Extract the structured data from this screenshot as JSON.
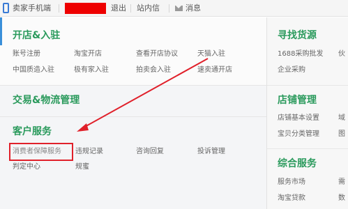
{
  "topbar": {
    "mobile_label": "卖家手机端",
    "logout": "退出",
    "messages_site": "站内信",
    "messages": "消息"
  },
  "sections": {
    "shop_open": {
      "title": "开店&入驻",
      "links": [
        "账号注册",
        "淘宝开店",
        "查看开店协议",
        "天猫入驻",
        "中国质造入驻",
        "极有家入驻",
        "拍卖会入驻",
        "速卖通开店"
      ]
    },
    "logistics": {
      "title": "交易&物流管理"
    },
    "customer": {
      "title": "客户服务",
      "links": [
        "消费者保障服务",
        "违规记录",
        "咨询回复",
        "投诉管理",
        "判定中心",
        "规蜜"
      ]
    }
  },
  "right": {
    "sourcing": {
      "title": "寻找货源",
      "links": [
        "1688采购批发",
        "伙",
        "企业采购"
      ]
    },
    "shop_mgmt": {
      "title": "店铺管理",
      "links": [
        "店铺基本设置",
        "域",
        "宝贝分类管理",
        "图"
      ]
    },
    "general": {
      "title": "综合服务",
      "links": [
        "服务市场",
        "需",
        "淘宝贷款",
        "数"
      ]
    }
  },
  "colors": {
    "heading": "#2a9a5c",
    "highlight": "#e0202a",
    "accent": "#3a8fd9"
  }
}
